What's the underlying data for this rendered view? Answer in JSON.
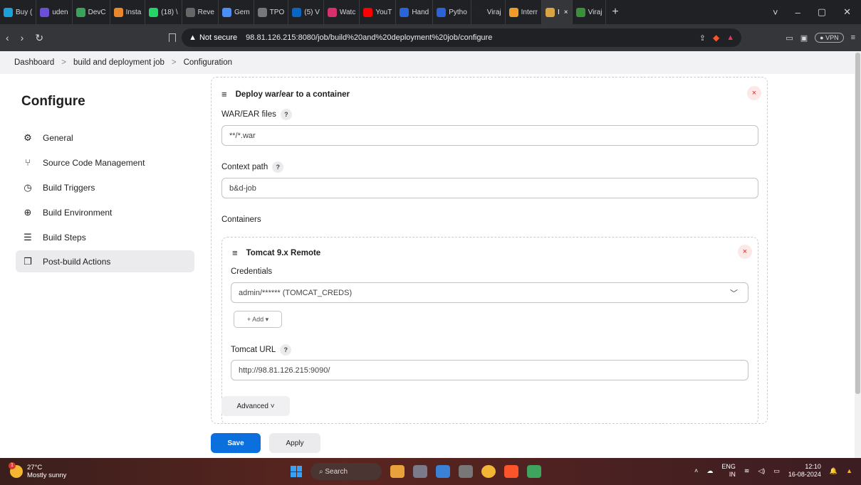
{
  "browser": {
    "tabs": [
      {
        "label": "Buy (",
        "icon": "d-icon",
        "color": "#1ba0d8"
      },
      {
        "label": "uden",
        "icon": "udemy-icon",
        "color": "#6b4fd8"
      },
      {
        "label": "DevC",
        "icon": "devc-icon",
        "color": "#3aa35b"
      },
      {
        "label": "Insta",
        "icon": "insta-icon",
        "color": "#e8872c"
      },
      {
        "label": "(18) \\",
        "icon": "whatsapp-icon",
        "color": "#25d366"
      },
      {
        "label": "Reve",
        "icon": "reve-icon",
        "color": "#666666"
      },
      {
        "label": "Gem",
        "icon": "gemini-icon",
        "color": "#4a8ef6"
      },
      {
        "label": "TPO",
        "icon": "tpo-icon",
        "color": "#777777"
      },
      {
        "label": "(5) V",
        "icon": "linkedin-icon",
        "color": "#0a66c2"
      },
      {
        "label": "Watc",
        "icon": "watch-icon",
        "color": "#d6316f"
      },
      {
        "label": "YouT",
        "icon": "youtube-icon",
        "color": "#ff0000"
      },
      {
        "label": "Hand",
        "icon": "c-icon",
        "color": "#2a64d8"
      },
      {
        "label": "Pytho",
        "icon": "c-icon",
        "color": "#2a64d8"
      },
      {
        "label": "Viraj",
        "icon": "github-icon",
        "color": "#222222"
      },
      {
        "label": "Interr",
        "icon": "inter-icon",
        "color": "#f09a2a"
      },
      {
        "label": "I",
        "icon": "jenkins-icon",
        "color": "#d9a441",
        "active": true
      },
      {
        "label": "Viraj",
        "icon": "viraj-icon",
        "color": "#3a8f3a"
      }
    ],
    "new_tab": "+",
    "not_secure": "Not secure",
    "url": "98.81.126.215:8080/job/build%20and%20deployment%20job/configure",
    "vpn": "VPN"
  },
  "breadcrumb": {
    "items": [
      "Dashboard",
      "build and deployment job",
      "Configuration"
    ],
    "separator": ">"
  },
  "sidebar": {
    "title": "Configure",
    "items": [
      {
        "label": "General",
        "icon": "gear-icon",
        "glyph": "⚙"
      },
      {
        "label": "Source Code Management",
        "icon": "branch-icon",
        "glyph": "⑂"
      },
      {
        "label": "Build Triggers",
        "icon": "clock-icon",
        "glyph": "◷"
      },
      {
        "label": "Build Environment",
        "icon": "globe-icon",
        "glyph": "⊕"
      },
      {
        "label": "Build Steps",
        "icon": "list-icon",
        "glyph": "☰"
      },
      {
        "label": "Post-build Actions",
        "icon": "box-icon",
        "glyph": "❒",
        "active": true
      }
    ]
  },
  "form": {
    "section_title": "Deploy war/ear to a container",
    "war_label": "WAR/EAR files",
    "war_value": "**/*.war",
    "context_label": "Context path",
    "context_value": "b&d-job",
    "containers_label": "Containers",
    "container_title": "Tomcat 9.x Remote",
    "credentials_label": "Credentials",
    "credentials_value": "admin/****** (TOMCAT_CREDS)",
    "add_label": "+ Add ▾",
    "tomcat_url_label": "Tomcat URL",
    "tomcat_url_value": "http://98.81.126.215:9090/",
    "advanced_label": "Advanced ˅",
    "help": "?",
    "close": "×"
  },
  "actions": {
    "save": "Save",
    "apply": "Apply"
  },
  "taskbar": {
    "temperature": "27°C",
    "weather": "Mostly sunny",
    "search": "Search",
    "lang": "ENG",
    "region": "IN",
    "time": "12:10",
    "date": "16-08-2024"
  }
}
